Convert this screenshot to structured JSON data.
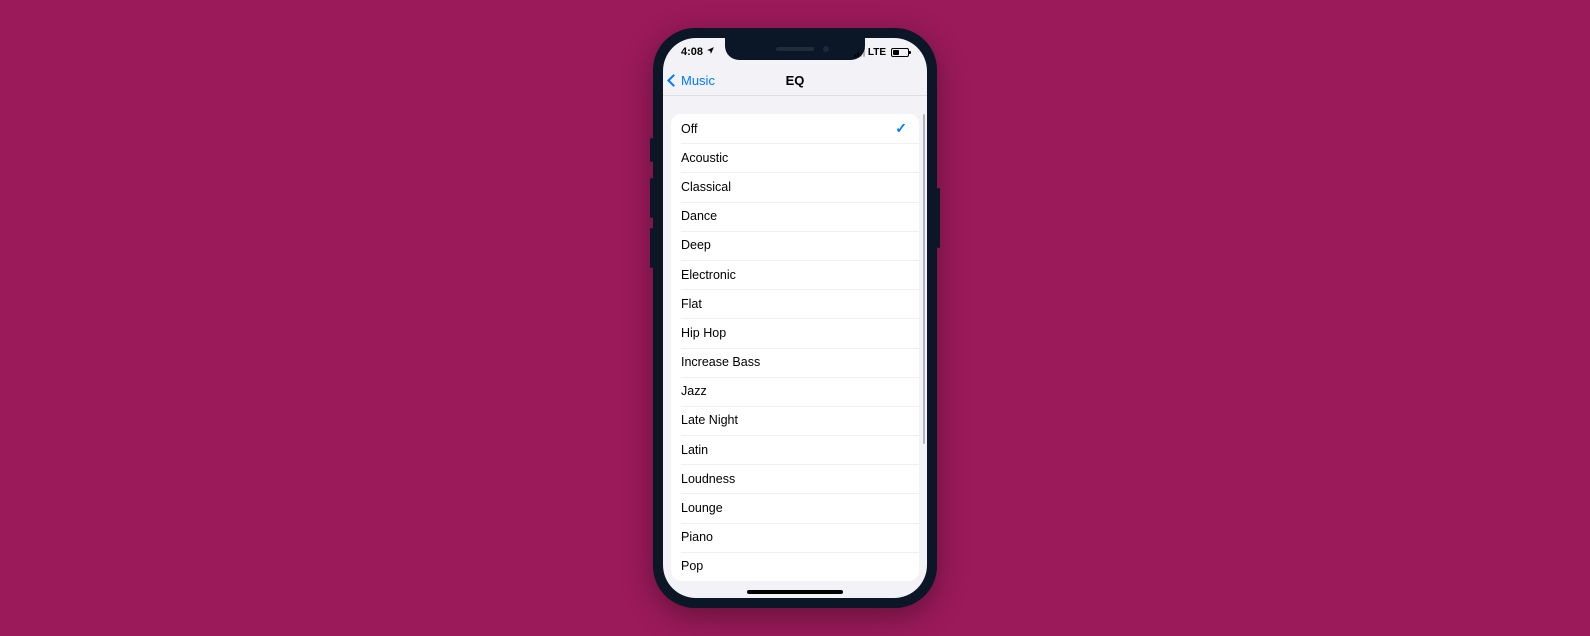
{
  "status": {
    "time": "4:08",
    "network": "LTE"
  },
  "nav": {
    "back_label": "Music",
    "title": "EQ"
  },
  "eq": {
    "selected_index": 0,
    "options": [
      {
        "label": "Off"
      },
      {
        "label": "Acoustic"
      },
      {
        "label": "Classical"
      },
      {
        "label": "Dance"
      },
      {
        "label": "Deep"
      },
      {
        "label": "Electronic"
      },
      {
        "label": "Flat"
      },
      {
        "label": "Hip Hop"
      },
      {
        "label": "Increase Bass"
      },
      {
        "label": "Jazz"
      },
      {
        "label": "Late Night"
      },
      {
        "label": "Latin"
      },
      {
        "label": "Loudness"
      },
      {
        "label": "Lounge"
      },
      {
        "label": "Piano"
      },
      {
        "label": "Pop"
      }
    ]
  }
}
